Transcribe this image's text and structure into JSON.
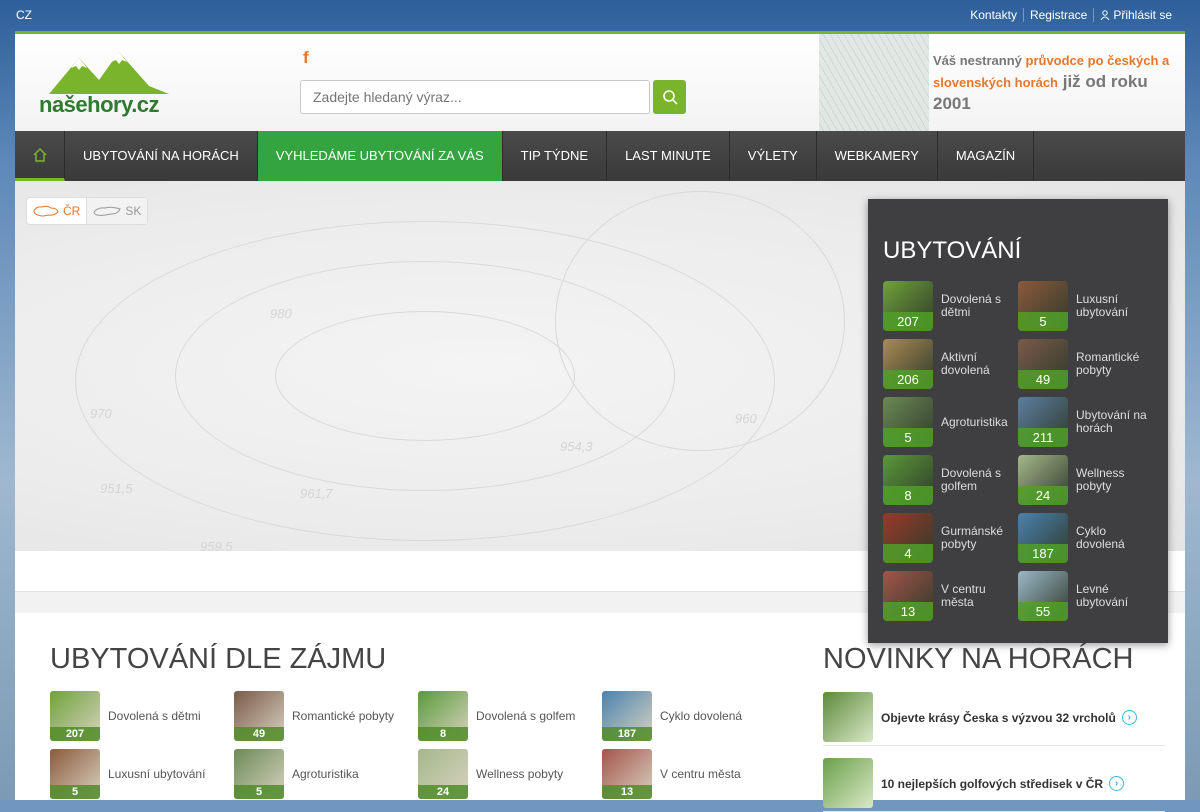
{
  "topbar": {
    "lang": "CZ",
    "links": [
      "Kontakty",
      "Registrace",
      "Přihlásit se"
    ]
  },
  "header": {
    "logo_a": "naše",
    "logo_b": "hory.cz",
    "fb": "f",
    "search_placeholder": "Zadejte hledaný výraz...",
    "tagline_1": "Váš nestranný ",
    "tagline_hl": "průvodce po českých a slovenských horách",
    "tagline_2": " již od roku 2001"
  },
  "nav": [
    "UBYTOVÁNÍ NA HORÁCH",
    "VYHLEDÁME UBYTOVÁNÍ ZA VÁS",
    "TIP TÝDNE",
    "LAST MINUTE",
    "VÝLETY",
    "WEBKAMERY",
    "MAGAZÍN"
  ],
  "map": {
    "cr": "ČR",
    "sk": "SK",
    "labels": [
      "980",
      "970",
      "954,3",
      "951,5",
      "961,7",
      "960",
      "959,5"
    ]
  },
  "panel": {
    "title": "UBYTOVÁNÍ",
    "items": [
      {
        "label": "Dovolená s dětmi",
        "count": "207",
        "color": "#6fa23a"
      },
      {
        "label": "Luxusní ubytování",
        "count": "5",
        "color": "#8b5a3c"
      },
      {
        "label": "Aktivní dovolená",
        "count": "206",
        "color": "#a98b55"
      },
      {
        "label": "Romantické pobyty",
        "count": "49",
        "color": "#7a5a4a"
      },
      {
        "label": "Agroturistika",
        "count": "5",
        "color": "#6b8a55"
      },
      {
        "label": "Ubytování na horách",
        "count": "211",
        "color": "#5b7ea0"
      },
      {
        "label": "Dovolená s golfem",
        "count": "8",
        "color": "#5a9a3a"
      },
      {
        "label": "Wellness pobyty",
        "count": "24",
        "color": "#a4b88a"
      },
      {
        "label": "Gurmánské pobyty",
        "count": "4",
        "color": "#9a3a2a"
      },
      {
        "label": "Cyklo dovolená",
        "count": "187",
        "color": "#4a82b0"
      },
      {
        "label": "V centru města",
        "count": "13",
        "color": "#a4544a"
      },
      {
        "label": "Levné ubytování",
        "count": "55",
        "color": "#9ab8c8"
      }
    ]
  },
  "zajem": {
    "title": "UBYTOVÁNÍ DLE ZÁJMU",
    "items": [
      {
        "label": "Dovolená s dětmi",
        "count": "207",
        "color": "#6fa23a"
      },
      {
        "label": "Romantické pobyty",
        "count": "49",
        "color": "#7a5a4a"
      },
      {
        "label": "Dovolená s golfem",
        "count": "8",
        "color": "#5a9a3a"
      },
      {
        "label": "Cyklo dovolená",
        "count": "187",
        "color": "#4a82b0"
      },
      {
        "label": "Luxusní ubytování",
        "count": "5",
        "color": "#8b5a3c"
      },
      {
        "label": "Agroturistika",
        "count": "5",
        "color": "#6b8a55"
      },
      {
        "label": "Wellness pobyty",
        "count": "24",
        "color": "#a4b88a"
      },
      {
        "label": "V centru města",
        "count": "13",
        "color": "#a4544a"
      }
    ]
  },
  "novinky": {
    "title": "NOVINKY NA HORÁCH",
    "items": [
      {
        "text": "Objevte krásy Česka s výzvou 32 vrcholů",
        "color": "#5c8a3a"
      },
      {
        "text": "10 nejlepších golfových středisek v ČR",
        "color": "#6aa04a"
      }
    ]
  }
}
